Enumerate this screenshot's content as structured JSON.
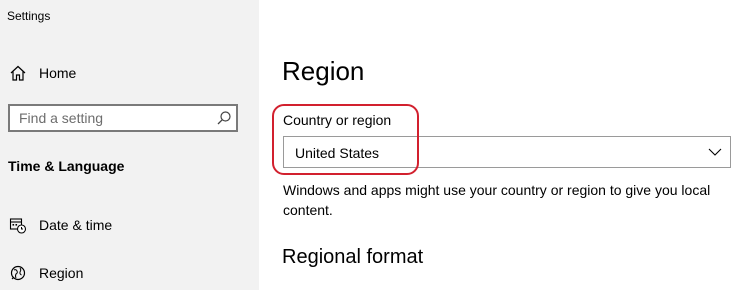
{
  "window": {
    "title": "Settings"
  },
  "sidebar": {
    "home_label": "Home",
    "search": {
      "placeholder": "Find a setting",
      "value": ""
    },
    "section_title": "Time & Language",
    "items": [
      {
        "label": "Date & time",
        "icon": "calendar-clock-icon"
      },
      {
        "label": "Region",
        "icon": "globe-icon"
      }
    ]
  },
  "main": {
    "title": "Region",
    "country_field": {
      "label": "Country or region",
      "selected": "United States"
    },
    "description": "Windows and apps might use your country or region to give you local content.",
    "regional_format_heading": "Regional format"
  },
  "colors": {
    "sidebar_bg": "#f2f2f2",
    "highlight": "#d2202e"
  }
}
